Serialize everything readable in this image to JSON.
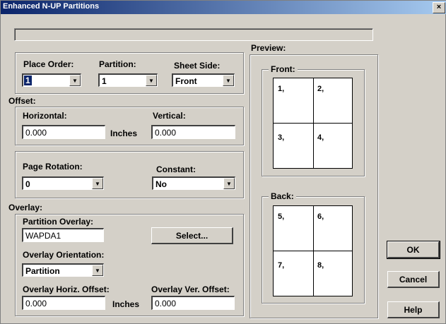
{
  "window": {
    "title": "Enhanced N-UP Partitions",
    "close_label": "×"
  },
  "order_group": {
    "place_order_label": "Place Order:",
    "place_order_value": "1",
    "partition_label": "Partition:",
    "partition_value": "1",
    "sheet_side_label": "Sheet Side:",
    "sheet_side_value": "Front"
  },
  "offset": {
    "section_label": "Offset:",
    "horizontal_label": "Horizontal:",
    "horizontal_value": "0.000",
    "units_label": "Inches",
    "vertical_label": "Vertical:",
    "vertical_value": "0.000"
  },
  "rotation_group": {
    "page_rotation_label": "Page Rotation:",
    "page_rotation_value": "0",
    "constant_label": "Constant:",
    "constant_value": "No"
  },
  "overlay": {
    "section_label": "Overlay:",
    "partition_overlay_label": "Partition Overlay:",
    "partition_overlay_value": "WAPDA1",
    "select_button": "Select...",
    "orientation_label": "Overlay Orientation:",
    "orientation_value": "Partition",
    "horiz_offset_label": "Overlay Horiz. Offset:",
    "horiz_offset_value": "0.000",
    "units_label": "Inches",
    "ver_offset_label": "Overlay Ver. Offset:",
    "ver_offset_value": "0.000"
  },
  "preview": {
    "label": "Preview:",
    "front_label": "Front:",
    "front_cells": [
      "1,",
      "2,",
      "3,",
      "4,"
    ],
    "back_label": "Back:",
    "back_cells": [
      "5,",
      "6,",
      "7,",
      "8,"
    ]
  },
  "buttons": {
    "ok": "OK",
    "cancel": "Cancel",
    "help": "Help"
  },
  "icons": {
    "dropdown": "chevron-down-icon",
    "close": "close-icon"
  }
}
